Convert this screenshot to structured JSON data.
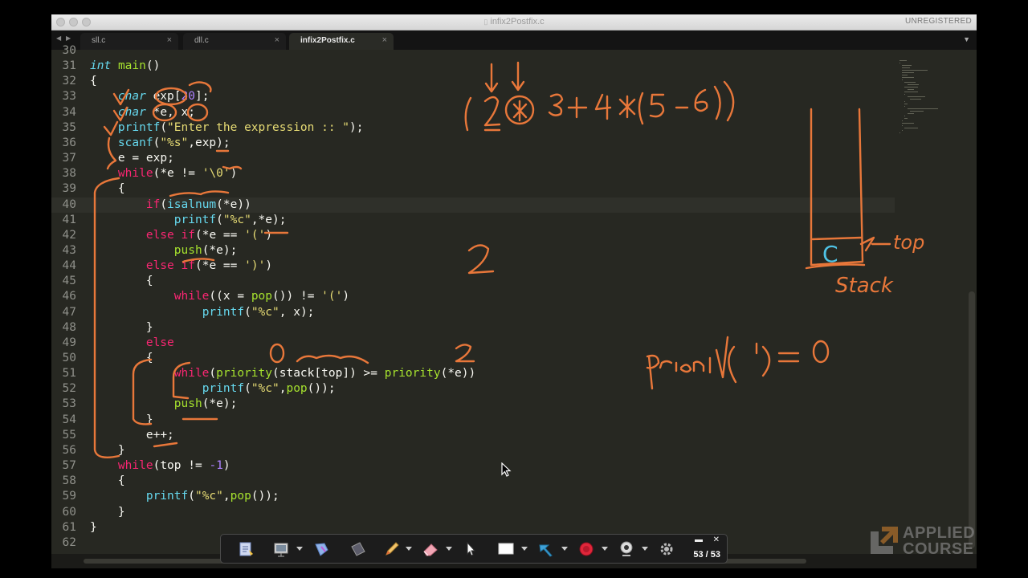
{
  "window": {
    "title": "infix2Postfix.c",
    "license": "UNREGISTERED"
  },
  "tabs": [
    {
      "label": "sll.c"
    },
    {
      "label": "dll.c"
    },
    {
      "label": "infix2Postfix.c",
      "active": true
    }
  ],
  "icons": {
    "tab_close": "×",
    "nav_back": "◀",
    "nav_forward": "▶",
    "tab_dropdown": "▼",
    "file_icon": "▯"
  },
  "editor": {
    "current_line": 40,
    "lines": [
      {
        "n": "30",
        "code": ""
      },
      {
        "n": "31",
        "code": "int main()"
      },
      {
        "n": "32",
        "code": "{"
      },
      {
        "n": "33",
        "code": "    char exp[20];"
      },
      {
        "n": "34",
        "code": "    char *e, x;"
      },
      {
        "n": "35",
        "code": "    printf(\"Enter the expression :: \");"
      },
      {
        "n": "36",
        "code": "    scanf(\"%s\",exp);"
      },
      {
        "n": "37",
        "code": "    e = exp;"
      },
      {
        "n": "38",
        "code": "    while(*e != '\\0')"
      },
      {
        "n": "39",
        "code": "    {"
      },
      {
        "n": "40",
        "code": "        if(isalnum(*e))"
      },
      {
        "n": "41",
        "code": "            printf(\"%c\",*e);"
      },
      {
        "n": "42",
        "code": "        else if(*e == '(')"
      },
      {
        "n": "43",
        "code": "            push(*e);"
      },
      {
        "n": "44",
        "code": "        else if(*e == ')')"
      },
      {
        "n": "45",
        "code": "        {"
      },
      {
        "n": "46",
        "code": "            while((x = pop()) != '(')"
      },
      {
        "n": "47",
        "code": "                printf(\"%c\", x);"
      },
      {
        "n": "48",
        "code": "        }"
      },
      {
        "n": "49",
        "code": "        else"
      },
      {
        "n": "50",
        "code": "        {"
      },
      {
        "n": "51",
        "code": "            while(priority(stack[top]) >= priority(*e))"
      },
      {
        "n": "52",
        "code": "                printf(\"%c\",pop());"
      },
      {
        "n": "53",
        "code": "            push(*e);"
      },
      {
        "n": "54",
        "code": "        }"
      },
      {
        "n": "55",
        "code": "        e++;"
      },
      {
        "n": "56",
        "code": "    }"
      },
      {
        "n": "57",
        "code": "    while(top != -1)"
      },
      {
        "n": "58",
        "code": "    {"
      },
      {
        "n": "59",
        "code": "        printf(\"%c\",pop());"
      },
      {
        "n": "60",
        "code": "    }"
      },
      {
        "n": "61",
        "code": "}"
      },
      {
        "n": "62",
        "code": ""
      }
    ]
  },
  "annotations": {
    "expression_note": "( 2 * 3 + 4 * ( 5 - 6 ) )",
    "stack_label": "Stack",
    "stack_item": "C",
    "top_label": "top",
    "two_note": "2",
    "zero_note": "0",
    "priority_note": "priority('(') = 0",
    "priority_two": "2"
  },
  "toolbar": {
    "page_indicator": "53 / 53",
    "tools": [
      "notes-icon",
      "presentation-icon",
      "highlighter-icon",
      "image-icon",
      "pen-icon",
      "eraser-icon",
      "pointer-icon",
      "whiteboard-icon",
      "marker-icon",
      "record-icon",
      "webcam-icon",
      "settings-icon"
    ],
    "minimize_glyph": "▬",
    "close_glyph": "✕",
    "record_color": "#e0263a"
  },
  "watermark": {
    "line1": "APPLIED",
    "line2": "COURSE"
  },
  "colors": {
    "ink": "#e8773a",
    "ink_blue": "#4fc3e6",
    "editor_bg": "#272822"
  }
}
